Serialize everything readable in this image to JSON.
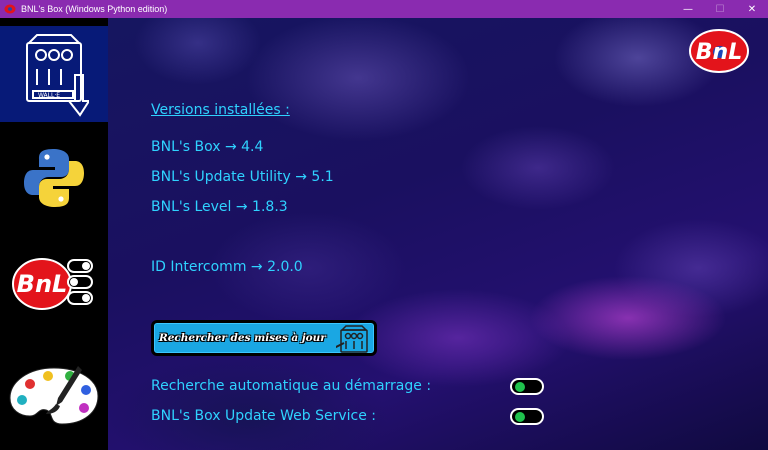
{
  "window": {
    "title": "BNL's Box (Windows Python edition)",
    "controls": {
      "minimize": "—",
      "maximize": "☐",
      "close": "✕"
    }
  },
  "sidebar": {
    "items": [
      {
        "name": "updates",
        "icon": "walle-update-icon",
        "active": true,
        "icon_text": "WALL·E"
      },
      {
        "name": "python",
        "icon": "python-icon",
        "active": false
      },
      {
        "name": "bnl-settings",
        "icon": "bnl-toggles-icon",
        "active": false,
        "icon_text": "BnL"
      },
      {
        "name": "themes",
        "icon": "palette-icon",
        "active": false
      }
    ]
  },
  "main": {
    "versions_title": "Versions installées :",
    "versions": [
      "BNL's Box → 4.4",
      "BNL's Update Utility → 5.1",
      "BNL's Level → 1.8.3",
      "ID Intercomm → 2.0.0"
    ],
    "update_button": "Rechercher des mises à jour",
    "settings": [
      {
        "label": "Recherche automatique au démarrage :",
        "enabled": true
      },
      {
        "label": "BNL's Box Update Web Service :",
        "enabled": true
      }
    ],
    "logo_text": "BnL"
  },
  "colors": {
    "titlebar": "#8a2bb0",
    "text_accent": "#2fd2ff",
    "button": "#1aa7e3",
    "toggle_on": "#1fc24d",
    "logo_red": "#e3141b",
    "logo_blue": "#1c46b8"
  }
}
